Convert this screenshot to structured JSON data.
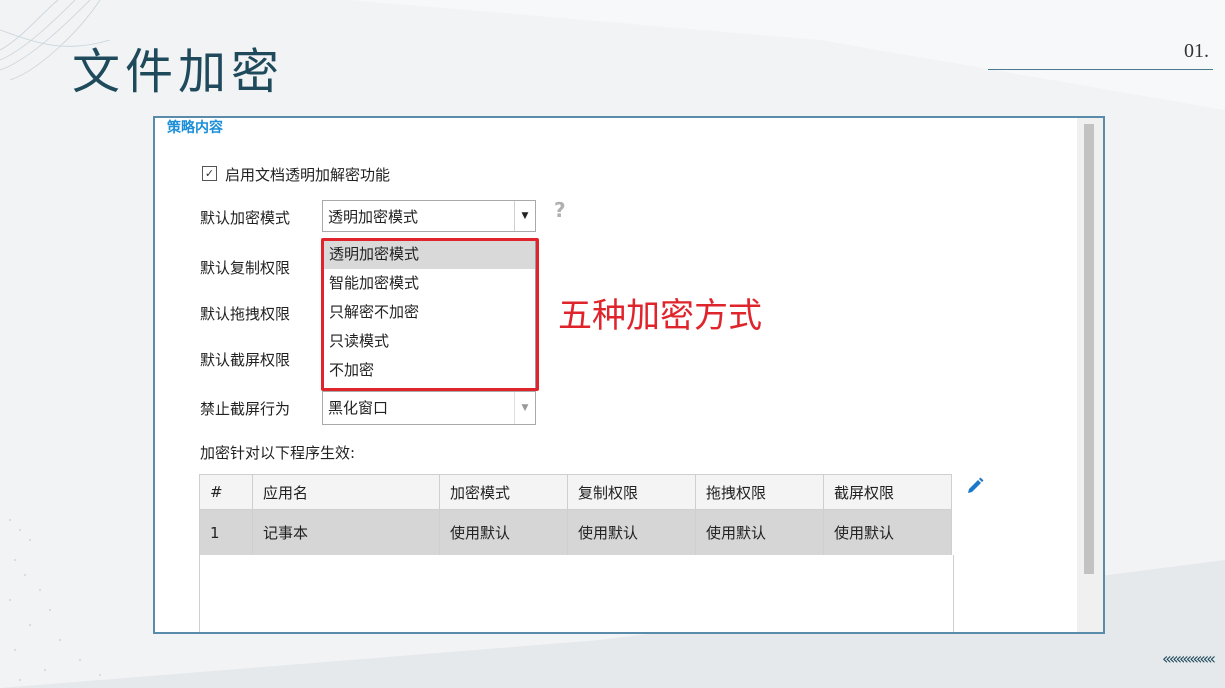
{
  "slide": {
    "title": "文件加密",
    "page_number": "01.",
    "chevrons": "‹‹‹‹‹‹‹‹‹‹‹‹‹‹‹"
  },
  "policy": {
    "section_title": "策略内容",
    "enable_checkbox_label": "启用文档透明加解密功能",
    "enable_checked": true,
    "default_encrypt_label": "默认加密模式",
    "default_encrypt_value": "透明加密模式",
    "default_copy_label": "默认复制权限",
    "default_drag_label": "默认拖拽权限",
    "default_screenshot_label": "默认截屏权限",
    "forbid_screenshot_label": "禁止截屏行为",
    "forbid_screenshot_value": "黑化窗口",
    "help_mark": "?",
    "dropdown_options": [
      "透明加密模式",
      "智能加密模式",
      "只解密不加密",
      "只读模式",
      "不加密"
    ],
    "annotation": "五种加密方式",
    "programs_label": "加密针对以下程序生效:"
  },
  "table": {
    "columns": [
      "#",
      "应用名",
      "加密模式",
      "复制权限",
      "拖拽权限",
      "截屏权限"
    ],
    "rows": [
      [
        "1",
        "记事本",
        "使用默认",
        "使用默认",
        "使用默认",
        "使用默认"
      ]
    ]
  },
  "colors": {
    "accent_blue": "#1c8fd8",
    "annotation_red": "#e0242b",
    "title_color": "#1f4a5c"
  }
}
